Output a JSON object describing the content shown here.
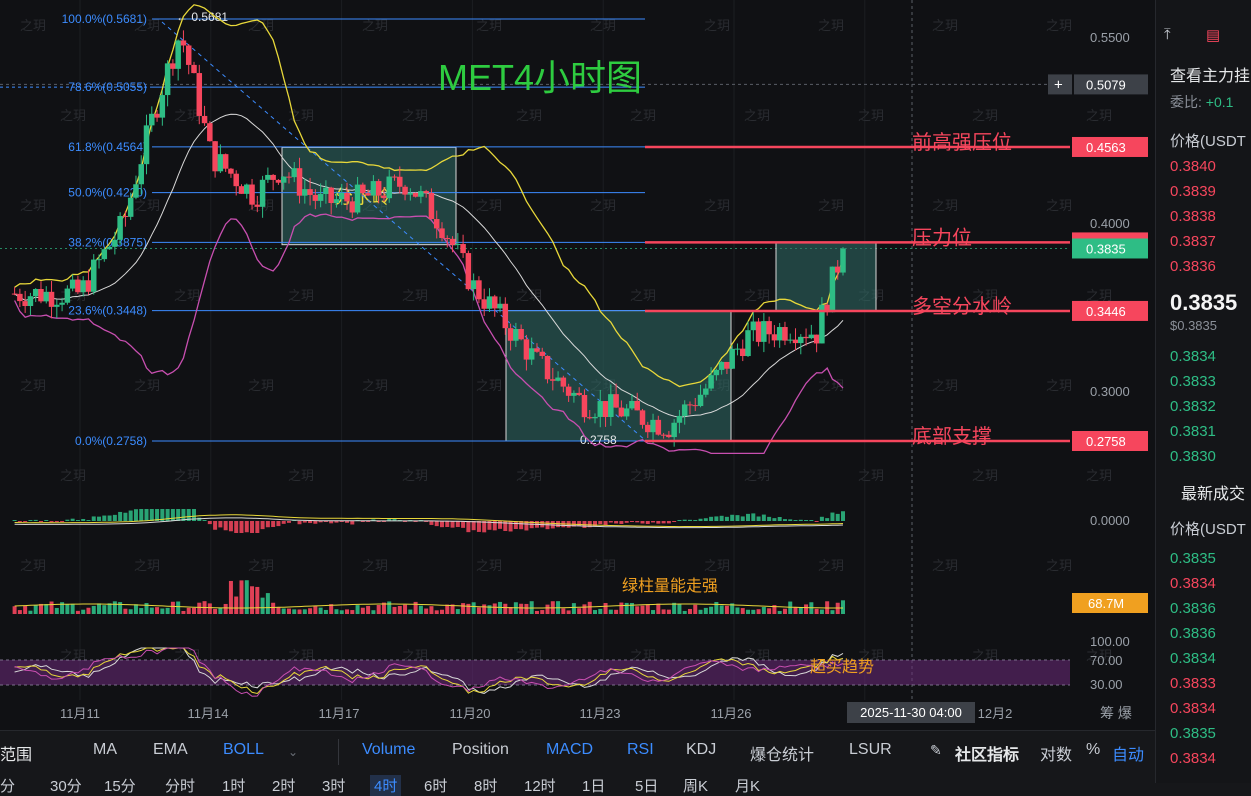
{
  "chart_data": {
    "type": "candlestick",
    "title": "MET4小时图",
    "y_axis": {
      "ticks": [
        "0.5500",
        "0.4000",
        "0.3000",
        "0.0000",
        "100.00",
        "70.00",
        "30.00"
      ]
    },
    "x_axis": {
      "ticks": [
        "11月11",
        "11月14",
        "11月17",
        "11月20",
        "11月23",
        "11月26",
        "12月2"
      ],
      "crosshair_label": "2025-11-30 04:00"
    },
    "price_range": [
      0.255,
      0.585
    ],
    "high_marker": "0.5681",
    "low_marker": "0.2758",
    "current_price": "0.3835",
    "crosshair_price": "0.5079",
    "fibonacci": [
      {
        "label": "100.0%(0.5681)",
        "level": 0.5681
      },
      {
        "label": "78.6%(0.5055)",
        "level": 0.5055
      },
      {
        "label": "61.8%(0.4564)",
        "level": 0.4564
      },
      {
        "label": "50.0%(0.4220)",
        "level": 0.422
      },
      {
        "label": "38.2%(0.3875)",
        "level": 0.3875
      },
      {
        "label": "23.6%(0.3448)",
        "level": 0.3448
      },
      {
        "label": "0.0%(0.2758)",
        "level": 0.2758
      }
    ],
    "levels": [
      {
        "name": "前高强压位",
        "price": "0.4563",
        "value": 0.4563
      },
      {
        "name": "压力位",
        "price": "0.3875",
        "value": 0.3875
      },
      {
        "name": "多空分水岭",
        "price": "0.3446",
        "value": 0.3446
      },
      {
        "name": "底部支撑",
        "price": "0.2758",
        "value": 0.2758
      }
    ],
    "zones": [
      {
        "label": "分水岭",
        "from": "11月15",
        "to": "11月19",
        "low": 0.386,
        "high": 0.456
      },
      {
        "label": "",
        "from": "11月21",
        "to": "11月26",
        "low": 0.2758,
        "high": 0.3448
      },
      {
        "label": "",
        "from": "11月28",
        "to": "11月29",
        "low": 0.3448,
        "high": 0.3875
      }
    ],
    "macd_label": "0.0000",
    "volume_label": "68.7M",
    "volume_annotation": "绿柱量能走强",
    "rsi_annotation": "超买趋势",
    "watermark": "之玥"
  },
  "bottom_toolbar": {
    "range_label": "范围",
    "indicators": [
      "MA",
      "EMA",
      "BOLL",
      "Volume",
      "Position",
      "MACD",
      "RSI",
      "KDJ",
      "爆仓统计",
      "LSUR"
    ],
    "community": "社区指标",
    "log_label": "对数",
    "pct_label": "%",
    "auto_label": "自动",
    "timeframes": [
      "分",
      "30分",
      "15分",
      "分时",
      "1时",
      "2时",
      "3时",
      "4时",
      "6时",
      "8时",
      "12时",
      "1日",
      "5日",
      "周K",
      "月K"
    ]
  },
  "right_panel": {
    "title": "查看主力挂",
    "ratio_label": "委比:",
    "ratio_value": "+0.1",
    "price_header": "价格(USDT",
    "asks": [
      "0.3840",
      "0.3839",
      "0.3838",
      "0.3837",
      "0.3836"
    ],
    "last_price": "0.3835",
    "last_price_sub": "$0.3835",
    "bids": [
      "0.3834",
      "0.3833",
      "0.3832",
      "0.3831",
      "0.3830"
    ],
    "trades_title": "最新成交",
    "trades_header": "价格(USDT",
    "trades": [
      {
        "price": "0.3835",
        "side": "buy"
      },
      {
        "price": "0.3834",
        "side": "sell"
      },
      {
        "price": "0.3836",
        "side": "buy"
      },
      {
        "price": "0.3836",
        "side": "buy"
      },
      {
        "price": "0.3834",
        "side": "buy"
      },
      {
        "price": "0.3833",
        "side": "sell"
      },
      {
        "price": "0.3834",
        "side": "sell"
      },
      {
        "price": "0.3835",
        "side": "buy"
      },
      {
        "price": "0.3834",
        "side": "sell"
      }
    ],
    "buy_color": "#2ebd85",
    "sell_color": "#f6465d"
  }
}
